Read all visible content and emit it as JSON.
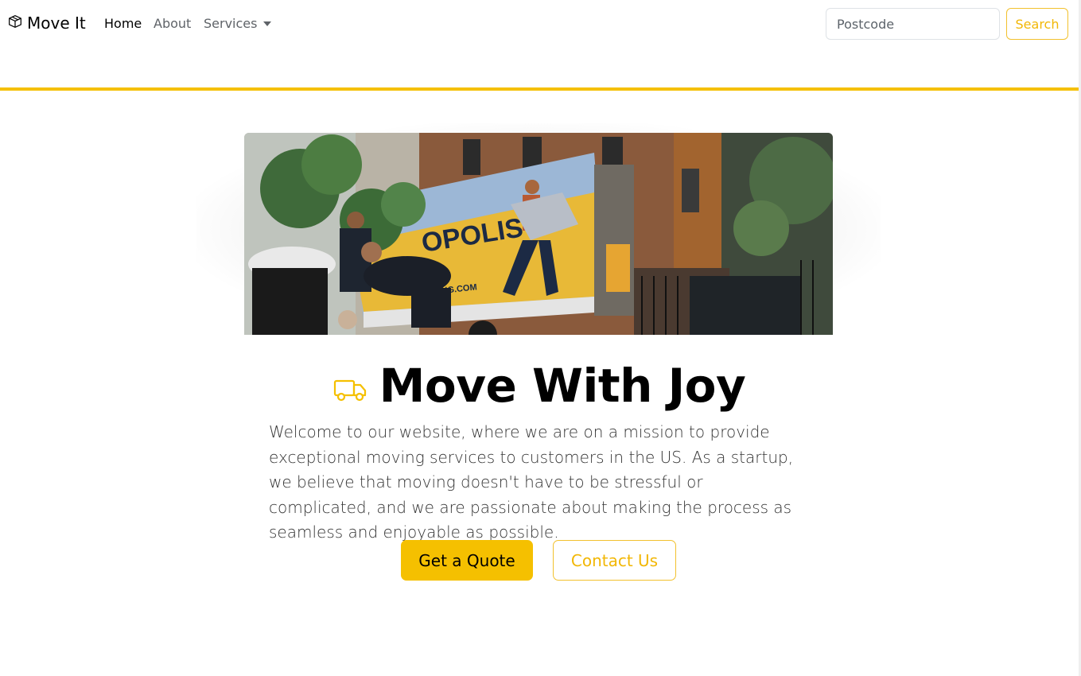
{
  "navbar": {
    "brand": "Move It",
    "brand_icon": "box-icon",
    "links": [
      {
        "label": "Home",
        "active": true
      },
      {
        "label": "About",
        "active": false
      },
      {
        "label": "Services",
        "active": false,
        "dropdown": true
      }
    ],
    "search": {
      "placeholder": "Postcode",
      "value": "",
      "button_label": "Search"
    }
  },
  "hero": {
    "image_alt": "Movers unloading a moving truck in front of brownstone buildings",
    "truck_brand_text": "OPOLIS",
    "truck_url_text": "MOVING.COM",
    "headline_icon": "truck-icon",
    "headline": "Move With Joy",
    "lead": "Welcome to our website, where we are on a mission to provide exceptional moving services to customers in the US. As a startup, we believe that moving doesn't have to be stressful or complicated, and we are passionate about making the process as seamless and enjoyable as possible.",
    "primary_button": "Get a Quote",
    "secondary_button": "Contact Us"
  },
  "colors": {
    "accent": "#f5c000",
    "accent_text": "#f2b705",
    "text": "#212529"
  }
}
